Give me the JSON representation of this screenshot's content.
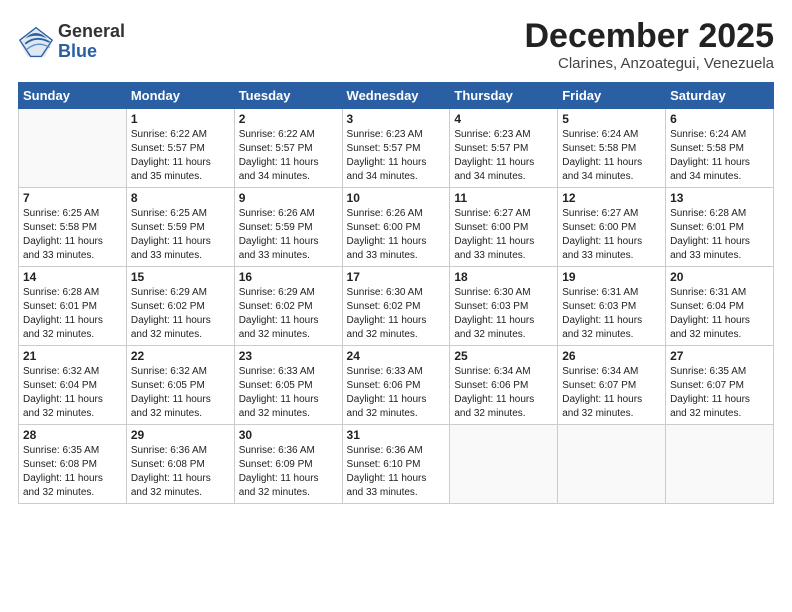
{
  "header": {
    "logo_general": "General",
    "logo_blue": "Blue",
    "month_title": "December 2025",
    "subtitle": "Clarines, Anzoategui, Venezuela"
  },
  "weekdays": [
    "Sunday",
    "Monday",
    "Tuesday",
    "Wednesday",
    "Thursday",
    "Friday",
    "Saturday"
  ],
  "weeks": [
    [
      {
        "day": "",
        "info": ""
      },
      {
        "day": "1",
        "info": "Sunrise: 6:22 AM\nSunset: 5:57 PM\nDaylight: 11 hours\nand 35 minutes."
      },
      {
        "day": "2",
        "info": "Sunrise: 6:22 AM\nSunset: 5:57 PM\nDaylight: 11 hours\nand 34 minutes."
      },
      {
        "day": "3",
        "info": "Sunrise: 6:23 AM\nSunset: 5:57 PM\nDaylight: 11 hours\nand 34 minutes."
      },
      {
        "day": "4",
        "info": "Sunrise: 6:23 AM\nSunset: 5:57 PM\nDaylight: 11 hours\nand 34 minutes."
      },
      {
        "day": "5",
        "info": "Sunrise: 6:24 AM\nSunset: 5:58 PM\nDaylight: 11 hours\nand 34 minutes."
      },
      {
        "day": "6",
        "info": "Sunrise: 6:24 AM\nSunset: 5:58 PM\nDaylight: 11 hours\nand 34 minutes."
      }
    ],
    [
      {
        "day": "7",
        "info": "Sunrise: 6:25 AM\nSunset: 5:58 PM\nDaylight: 11 hours\nand 33 minutes."
      },
      {
        "day": "8",
        "info": "Sunrise: 6:25 AM\nSunset: 5:59 PM\nDaylight: 11 hours\nand 33 minutes."
      },
      {
        "day": "9",
        "info": "Sunrise: 6:26 AM\nSunset: 5:59 PM\nDaylight: 11 hours\nand 33 minutes."
      },
      {
        "day": "10",
        "info": "Sunrise: 6:26 AM\nSunset: 6:00 PM\nDaylight: 11 hours\nand 33 minutes."
      },
      {
        "day": "11",
        "info": "Sunrise: 6:27 AM\nSunset: 6:00 PM\nDaylight: 11 hours\nand 33 minutes."
      },
      {
        "day": "12",
        "info": "Sunrise: 6:27 AM\nSunset: 6:00 PM\nDaylight: 11 hours\nand 33 minutes."
      },
      {
        "day": "13",
        "info": "Sunrise: 6:28 AM\nSunset: 6:01 PM\nDaylight: 11 hours\nand 33 minutes."
      }
    ],
    [
      {
        "day": "14",
        "info": "Sunrise: 6:28 AM\nSunset: 6:01 PM\nDaylight: 11 hours\nand 32 minutes."
      },
      {
        "day": "15",
        "info": "Sunrise: 6:29 AM\nSunset: 6:02 PM\nDaylight: 11 hours\nand 32 minutes."
      },
      {
        "day": "16",
        "info": "Sunrise: 6:29 AM\nSunset: 6:02 PM\nDaylight: 11 hours\nand 32 minutes."
      },
      {
        "day": "17",
        "info": "Sunrise: 6:30 AM\nSunset: 6:02 PM\nDaylight: 11 hours\nand 32 minutes."
      },
      {
        "day": "18",
        "info": "Sunrise: 6:30 AM\nSunset: 6:03 PM\nDaylight: 11 hours\nand 32 minutes."
      },
      {
        "day": "19",
        "info": "Sunrise: 6:31 AM\nSunset: 6:03 PM\nDaylight: 11 hours\nand 32 minutes."
      },
      {
        "day": "20",
        "info": "Sunrise: 6:31 AM\nSunset: 6:04 PM\nDaylight: 11 hours\nand 32 minutes."
      }
    ],
    [
      {
        "day": "21",
        "info": "Sunrise: 6:32 AM\nSunset: 6:04 PM\nDaylight: 11 hours\nand 32 minutes."
      },
      {
        "day": "22",
        "info": "Sunrise: 6:32 AM\nSunset: 6:05 PM\nDaylight: 11 hours\nand 32 minutes."
      },
      {
        "day": "23",
        "info": "Sunrise: 6:33 AM\nSunset: 6:05 PM\nDaylight: 11 hours\nand 32 minutes."
      },
      {
        "day": "24",
        "info": "Sunrise: 6:33 AM\nSunset: 6:06 PM\nDaylight: 11 hours\nand 32 minutes."
      },
      {
        "day": "25",
        "info": "Sunrise: 6:34 AM\nSunset: 6:06 PM\nDaylight: 11 hours\nand 32 minutes."
      },
      {
        "day": "26",
        "info": "Sunrise: 6:34 AM\nSunset: 6:07 PM\nDaylight: 11 hours\nand 32 minutes."
      },
      {
        "day": "27",
        "info": "Sunrise: 6:35 AM\nSunset: 6:07 PM\nDaylight: 11 hours\nand 32 minutes."
      }
    ],
    [
      {
        "day": "28",
        "info": "Sunrise: 6:35 AM\nSunset: 6:08 PM\nDaylight: 11 hours\nand 32 minutes."
      },
      {
        "day": "29",
        "info": "Sunrise: 6:36 AM\nSunset: 6:08 PM\nDaylight: 11 hours\nand 32 minutes."
      },
      {
        "day": "30",
        "info": "Sunrise: 6:36 AM\nSunset: 6:09 PM\nDaylight: 11 hours\nand 32 minutes."
      },
      {
        "day": "31",
        "info": "Sunrise: 6:36 AM\nSunset: 6:10 PM\nDaylight: 11 hours\nand 33 minutes."
      },
      {
        "day": "",
        "info": ""
      },
      {
        "day": "",
        "info": ""
      },
      {
        "day": "",
        "info": ""
      }
    ]
  ]
}
